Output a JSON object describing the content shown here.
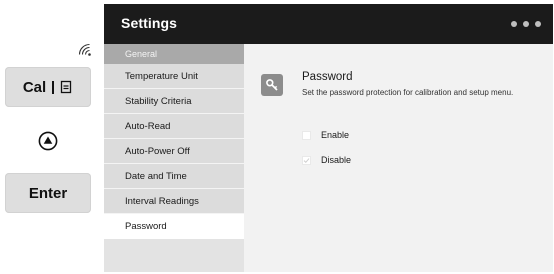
{
  "hardware": {
    "cal_label": "Cal",
    "enter_label": "Enter",
    "icons": [
      "signal-icon",
      "document-icon",
      "up-arrow-icon"
    ]
  },
  "screen": {
    "title": "Settings",
    "page_dots": 3
  },
  "sidebar": {
    "items": [
      {
        "label": "General"
      },
      {
        "label": "Temperature Unit"
      },
      {
        "label": "Stability Criteria"
      },
      {
        "label": "Auto-Read"
      },
      {
        "label": "Auto-Power Off"
      },
      {
        "label": "Date and Time"
      },
      {
        "label": "Interval Readings"
      },
      {
        "label": "Password"
      }
    ],
    "active": "Password"
  },
  "content": {
    "icon": "key-icon",
    "title": "Password",
    "description": "Set the password protection for calibration and setup menu.",
    "options": [
      {
        "label": "Enable",
        "checked": false
      },
      {
        "label": "Disable",
        "checked": true
      }
    ]
  },
  "colors": {
    "titlebar": "#1b1b1b",
    "sidebar_header": "#a9a9a9",
    "key_icon_bg": "#8c8c8c"
  }
}
